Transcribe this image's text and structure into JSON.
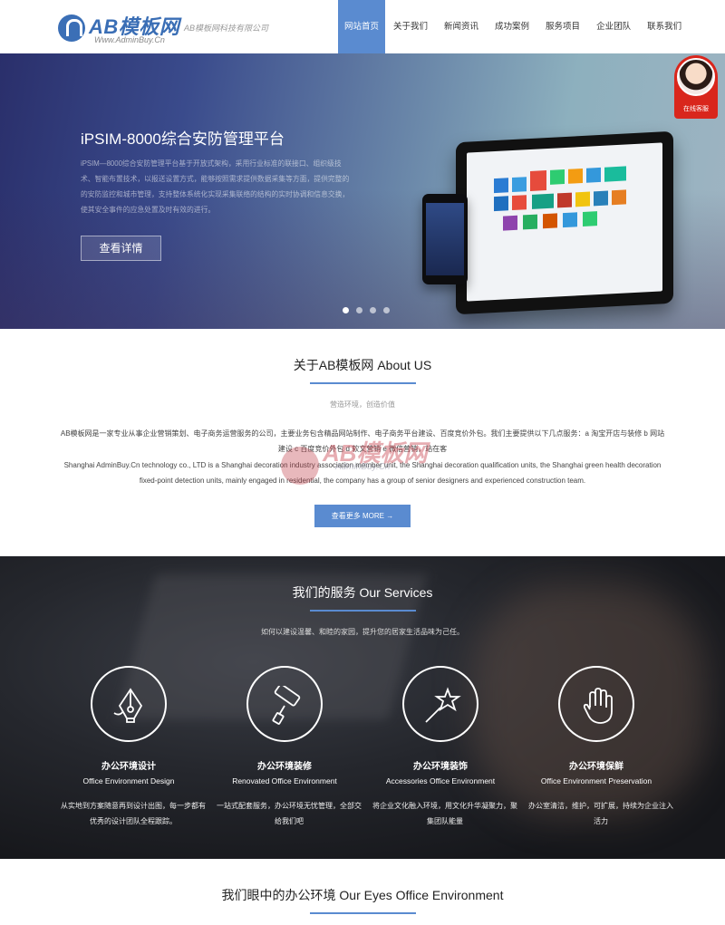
{
  "header": {
    "logo_main": "AB模板网",
    "logo_sub": "Www.AdminBuy.Cn",
    "company": "AB模板网科技有限公司",
    "nav": [
      "网站首页",
      "关于我们",
      "新闻资讯",
      "成功案例",
      "服务项目",
      "企业团队",
      "联系我们"
    ],
    "active_nav": 0
  },
  "hero": {
    "title": "iPSIM-8000综合安防管理平台",
    "description": "iPSIM—8000综合安防管理平台基于开放式架构，采用行业标准的联接口、组织级技术、智能布置技术，以报送设置方式，能够按照需求提供数据采集等方面，提供完整的的安防监控和城市管理，支持整体系统化实现采集联络的结构的实时协调和信息交换，使其安全事件的应急处置及时有效的进行。",
    "button": "查看详情",
    "slides": 4,
    "active_slide": 0
  },
  "customer_service": {
    "label": "在线客服"
  },
  "about": {
    "title": "关于AB模板网 About US",
    "subtitle": "营造环境，创造价值",
    "text_cn": "AB模板网是一家专业从事企业营销策划、电子商务运营服务的公司，主要业务包含精品网站制作、电子商务平台建设、百度竞价外包。我们主要提供以下几点服务：a 淘宝开店与装修 b 网站建设 c 百度竞价外包 d 软文营销 e 微信营销，站在客",
    "text_en": "Shanghai AdminBuy.Cn technology co., LTD is a Shanghai decoration industry association member unit, the Shanghai decoration qualification units, the Shanghai green health decoration fixed-point detection units, mainly engaged in residential, the company has a group of senior designers and experienced construction team.",
    "watermark_main": "AB模板网",
    "watermark_sub": "AdminBuy.Cn",
    "more_button": "查看更多 MORE →"
  },
  "services": {
    "title": "我们的服务 Our Services",
    "subtitle": "如何以建设温馨、和睦的家园，提升您的居家生活品味为己任。",
    "items": [
      {
        "icon": "pen-nib-icon",
        "name": "办公环境设计",
        "en": "Office Environment Design",
        "desc": "从实地到方案随意再到设计出图，每一步都有优秀的设计团队全程跟踪。"
      },
      {
        "icon": "paint-roller-icon",
        "name": "办公环境装修",
        "en": "Renovated Office Environment",
        "desc": "一站式配套服务，办公环境无忧管理，全部交给我们吧"
      },
      {
        "icon": "magic-wand-icon",
        "name": "办公环境装饰",
        "en": "Accessories Office Environment",
        "desc": "将企业文化融入环境，用文化升华凝聚力，聚集团队能量"
      },
      {
        "icon": "hand-icon",
        "name": "办公环境保鲜",
        "en": "Office Environment Preservation",
        "desc": "办公室清洁，维护，可扩展，持续为企业注入活力"
      }
    ]
  },
  "bottom": {
    "title": "我们眼中的办公环境 Our Eyes Office Environment"
  },
  "colors": {
    "accent": "#5a8bd0",
    "cs_red": "#d9261c"
  }
}
